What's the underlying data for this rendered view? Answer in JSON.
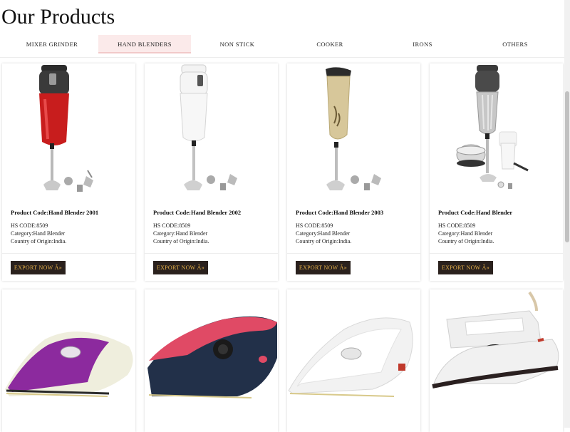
{
  "page": {
    "title": "Our Products"
  },
  "tabs": [
    {
      "label": "MIXER GRINDER",
      "active": false
    },
    {
      "label": "HAND BLENDERS",
      "active": true
    },
    {
      "label": "NON STICK",
      "active": false
    },
    {
      "label": "COOKER",
      "active": false
    },
    {
      "label": "IRONS",
      "active": false
    },
    {
      "label": "OTHERS",
      "active": false
    }
  ],
  "products": [
    {
      "code": "Product Code:Hand Blender 2001",
      "hs": "HS CODE:8509",
      "category": "Category:Hand Blender",
      "origin": "Country of Origin:India.",
      "button": "EXPORT NOW Â»",
      "image": "red-hand-blender"
    },
    {
      "code": "Product Code:Hand Blender 2002",
      "hs": "HS CODE:8509",
      "category": "Category:Hand Blender",
      "origin": "Country of Origin:India.",
      "button": "EXPORT NOW Â»",
      "image": "white-hand-blender"
    },
    {
      "code": "Product Code:Hand Blender 2003",
      "hs": "HS CODE:8509",
      "category": "Category:Hand Blender",
      "origin": "Country of Origin:India.",
      "button": "EXPORT NOW Â»",
      "image": "gold-hand-blender"
    },
    {
      "code": "Product Code:Hand Blender",
      "hs": "HS CODE:8509",
      "category": "Category:Hand Blender",
      "origin": "Country of Origin:India.",
      "button": "EXPORT NOW Â»",
      "image": "steel-hand-blender-set"
    }
  ],
  "irons": [
    {
      "image": "purple-iron"
    },
    {
      "image": "pink-navy-iron"
    },
    {
      "image": "white-iron"
    },
    {
      "image": "black-white-iron"
    }
  ],
  "colors": {
    "button_bg": "#2a211d",
    "button_text": "#e8b24a",
    "active_tab": "#fbeaea"
  }
}
